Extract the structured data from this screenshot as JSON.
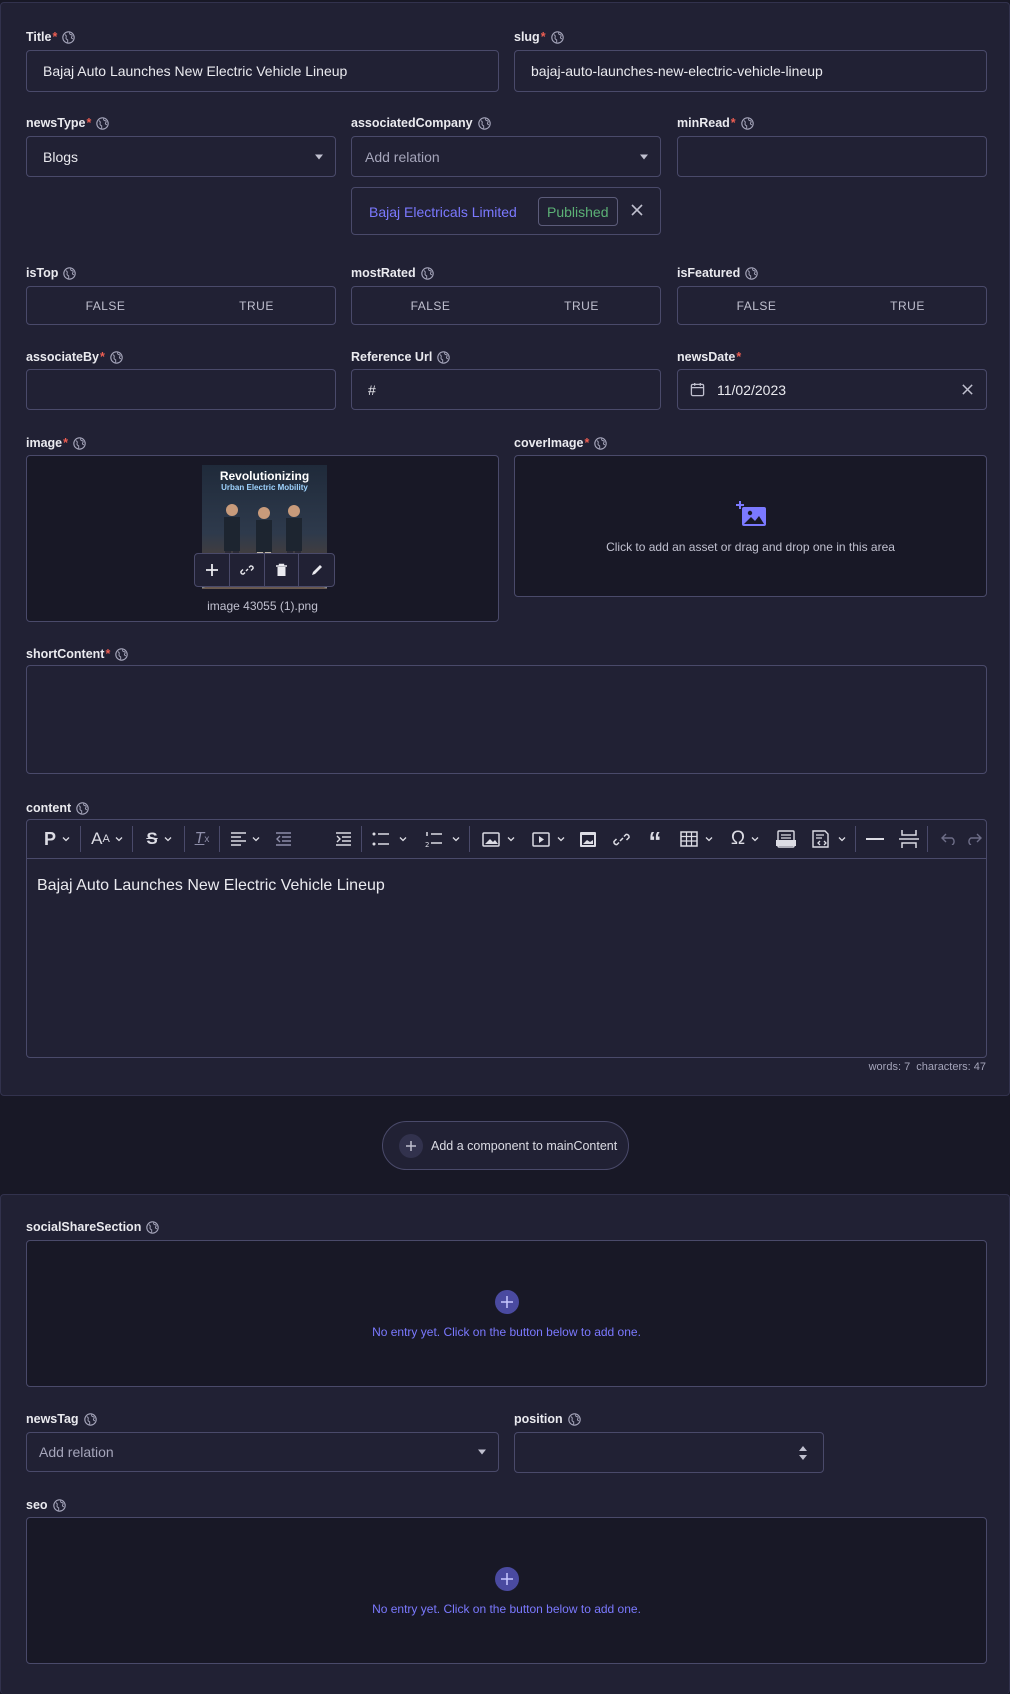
{
  "fields": {
    "title": {
      "label": "Title",
      "value": "Bajaj Auto Launches New Electric Vehicle Lineup"
    },
    "slug": {
      "label": "slug",
      "value": "bajaj-auto-launches-new-electric-vehicle-lineup"
    },
    "newsType": {
      "label": "newsType",
      "value": "Blogs"
    },
    "associatedCompany": {
      "label": "associatedCompany",
      "placeholder": "Add relation",
      "relation_name": "Bajaj Electricals Limited",
      "relation_status": "Published"
    },
    "minRead": {
      "label": "minRead",
      "value": ""
    },
    "isTop": {
      "label": "isTop",
      "false_label": "FALSE",
      "true_label": "TRUE"
    },
    "mostRated": {
      "label": "mostRated",
      "false_label": "FALSE",
      "true_label": "TRUE"
    },
    "isFeatured": {
      "label": "isFeatured",
      "false_label": "FALSE",
      "true_label": "TRUE"
    },
    "associateBy": {
      "label": "associateBy",
      "value": ""
    },
    "referenceUrl": {
      "label": "Reference Url",
      "value": "#"
    },
    "newsDate": {
      "label": "newsDate",
      "value": "11/02/2023"
    },
    "image": {
      "label": "image",
      "filename": "image 43055 (1).png",
      "thumb_line1": "Revolutionizing",
      "thumb_line2": "Urban Electric Mobility"
    },
    "coverImage": {
      "label": "coverImage",
      "empty_text": "Click to add an asset or drag and drop one in this area"
    },
    "shortContent": {
      "label": "shortContent",
      "value": ""
    },
    "content": {
      "label": "content",
      "text": "Bajaj Auto Launches New Electric Vehicle Lineup",
      "stats": "words: 7  characters: 47"
    }
  },
  "add_component_label": "Add a component to mainContent",
  "socialShareSection": {
    "label": "socialShareSection",
    "empty_text": "No entry yet. Click on the button below to add one."
  },
  "newsTag": {
    "label": "newsTag",
    "placeholder": "Add relation"
  },
  "position": {
    "label": "position",
    "value": ""
  },
  "seo": {
    "label": "seo",
    "empty_text": "No entry yet. Click on the button below to add one."
  },
  "colors": {
    "accent": "#7b79ff",
    "published": "#5cb176",
    "required": "#ee5e52",
    "panel": "#212134",
    "background": "#181826"
  }
}
